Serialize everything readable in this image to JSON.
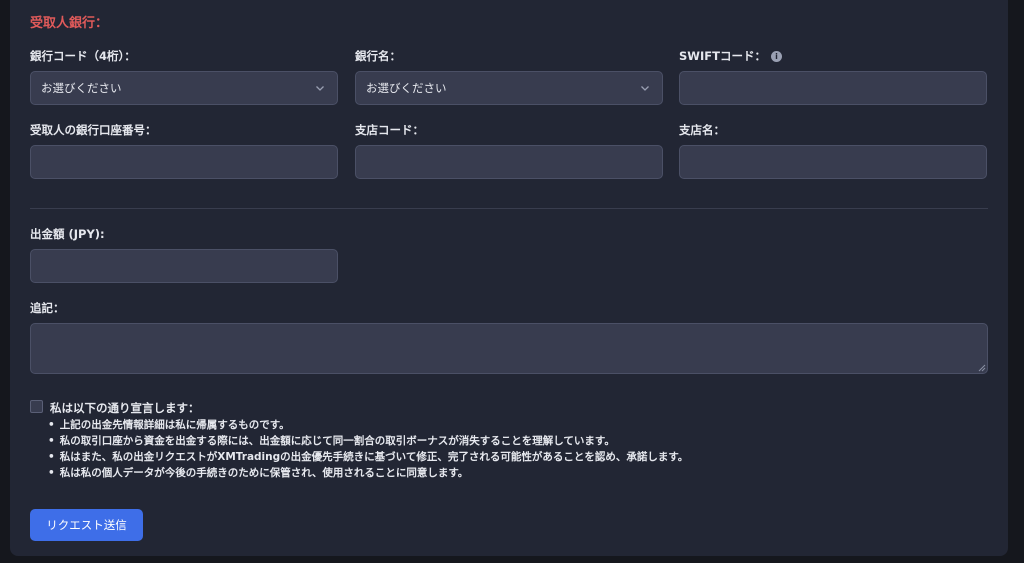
{
  "section_title": "受取人銀行：",
  "fields": {
    "bank_code": {
      "label": "銀行コード（4桁）：",
      "value": "お選びください"
    },
    "bank_name": {
      "label": "銀行名：",
      "value": "お選びください"
    },
    "swift_code": {
      "label": "SWIFTコード：",
      "value": ""
    },
    "account_number": {
      "label": "受取人の銀行口座番号：",
      "value": ""
    },
    "branch_code": {
      "label": "支店コード：",
      "value": ""
    },
    "branch_name": {
      "label": "支店名：",
      "value": ""
    },
    "amount": {
      "label": "出金額 (JPY):",
      "value": ""
    },
    "notes": {
      "label": "追記：",
      "value": ""
    }
  },
  "declaration": {
    "title": "私は以下の通り宣言します：",
    "items": [
      "上記の出金先情報詳細は私に帰属するものです。",
      "私の取引口座から資金を出金する際には、出金額に応じて同一割合の取引ボーナスが消失することを理解しています。",
      "私はまた、私の出金リクエストがXMTradingの出金優先手続きに基づいて修正、完了される可能性があることを認め、承諾します。",
      "私は私の個人データが今後の手続きのために保管され、使用されることに同意します。"
    ],
    "checked": false
  },
  "submit_label": "リクエスト送信",
  "icons": {
    "swift_info": "info-icon",
    "select_arrow": "chevron-down-icon"
  },
  "colors": {
    "accent": "#3e6ee8",
    "title": "#e05a5a",
    "panel": "#222634",
    "field": "#383c4f"
  }
}
